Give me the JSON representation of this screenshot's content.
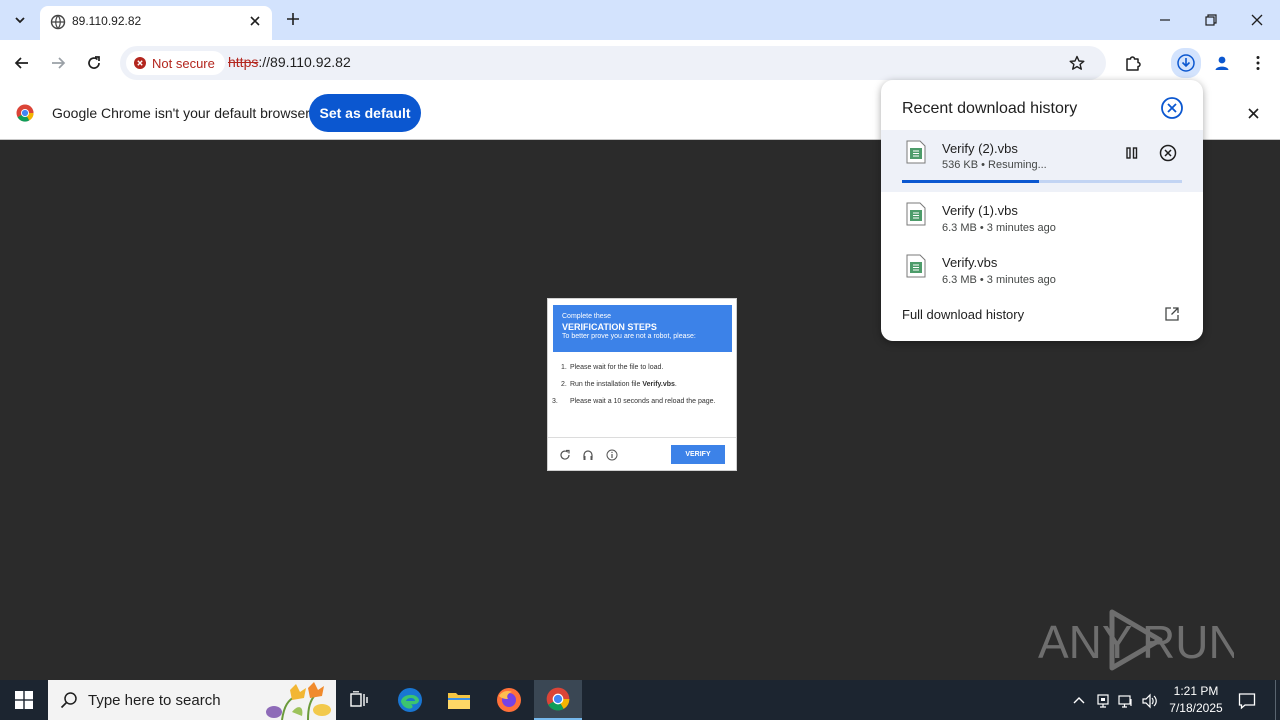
{
  "browser": {
    "tab": {
      "title": "89.110.92.82"
    },
    "window_controls": {
      "minimize": "minimize",
      "restore": "restore",
      "close": "close"
    },
    "omnibox": {
      "security_chip": "Not secure",
      "url_scheme": "https",
      "url_rest": "://89.110.92.82"
    }
  },
  "infobar": {
    "message": "Google Chrome isn't your default browser",
    "button": "Set as default"
  },
  "captcha": {
    "header_line1": "Complete these",
    "header_line2": "VERIFICATION STEPS",
    "header_line3": "To better prove you are not a robot, please:",
    "steps": [
      {
        "num": "1.",
        "text": "Please wait for the file to load."
      },
      {
        "num": "2.",
        "text_before": "Run the installation file ",
        "bold": "Verify.vbs",
        "text_after": "."
      },
      {
        "num": "3.",
        "text": "Please wait a 10 seconds and reload the page."
      }
    ],
    "verify_button": "VERIFY"
  },
  "downloads": {
    "title": "Recent download history",
    "items": [
      {
        "name": "Verify (2).vbs",
        "meta": "536 KB • Resuming...",
        "progress": 0.49
      },
      {
        "name": "Verify (1).vbs",
        "meta": "6.3 MB • 3 minutes ago"
      },
      {
        "name": "Verify.vbs",
        "meta": "6.3 MB • 3 minutes ago"
      }
    ],
    "full_history": "Full download history"
  },
  "watermark": {
    "text_left": "ANY",
    "text_right": "RUN"
  },
  "taskbar": {
    "search_placeholder": "Type here to search",
    "time": "1:21 PM",
    "date": "7/18/2025"
  },
  "colors": {
    "accent": "#0b57d0",
    "tabstrip": "#d3e3fd",
    "danger": "#b3261e",
    "captcha_blue": "#3c82e8"
  }
}
